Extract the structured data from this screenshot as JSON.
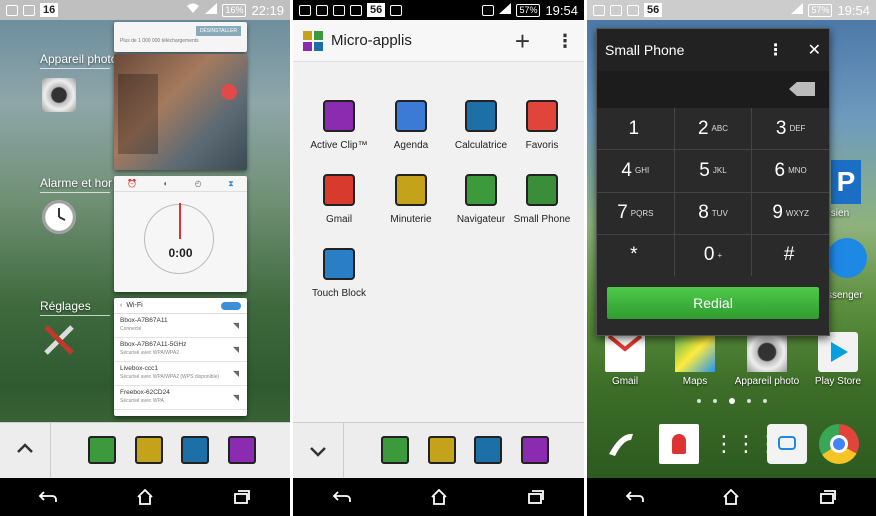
{
  "screen1": {
    "status": {
      "notif_count": "16",
      "battery": "16%",
      "time": "22:19"
    },
    "labels": {
      "camera": "Appareil photo",
      "alarm": "Alarme et hor",
      "settings": "Réglages"
    },
    "card_top_text": "Plus de 1 000 000 téléchargements",
    "card_top_button": "DÉSINSTALLER",
    "timer_value": "0:00",
    "wifi": {
      "title": "Wi-Fi",
      "networks": [
        {
          "name": "Bbox-A7B67A11",
          "status": "Connecté"
        },
        {
          "name": "Bbox-A7B67A11-5GHz",
          "status": "Sécurisé avec WPA/WPA2"
        },
        {
          "name": "Livebox-ccc1",
          "status": "Sécurisé avec WPA/WPA2 (WPS disponible)"
        },
        {
          "name": "Freebox-62CD24",
          "status": "Sécurisé avec WPA"
        }
      ]
    }
  },
  "screen2": {
    "status": {
      "notif_count": "56",
      "battery": "57%",
      "time": "19:54"
    },
    "title": "Micro-applis",
    "apps": [
      {
        "label": "Active Clip™",
        "color": "#8b2bb0"
      },
      {
        "label": "Agenda",
        "color": "#3b7bd6"
      },
      {
        "label": "Calculatrice",
        "color": "#1d6fa8"
      },
      {
        "label": "Favoris",
        "color": "#e0443a"
      },
      {
        "label": "Gmail",
        "color": "#d93a2e"
      },
      {
        "label": "Minuterie",
        "color": "#c4a21a"
      },
      {
        "label": "Navigateur",
        "color": "#3c9a3c"
      },
      {
        "label": "Small Phone",
        "color": "#3a8e3a"
      },
      {
        "label": "Touch Block",
        "color": "#2a7fc4"
      }
    ]
  },
  "screen3": {
    "status": {
      "notif_count": "56",
      "battery": "57%",
      "time": "19:54"
    },
    "phone_title": "Small Phone",
    "keys": [
      {
        "d": "1",
        "l": ""
      },
      {
        "d": "2",
        "l": "ABC"
      },
      {
        "d": "3",
        "l": "DEF"
      },
      {
        "d": "4",
        "l": "GHI"
      },
      {
        "d": "5",
        "l": "JKL"
      },
      {
        "d": "6",
        "l": "MNO"
      },
      {
        "d": "7",
        "l": "PQRS"
      },
      {
        "d": "8",
        "l": "TUV"
      },
      {
        "d": "9",
        "l": "WXYZ"
      },
      {
        "d": "*",
        "l": ""
      },
      {
        "d": "0",
        "l": "+"
      },
      {
        "d": "#",
        "l": ""
      }
    ],
    "redial": "Redial",
    "apps": {
      "gmail": "Gmail",
      "maps": "Maps",
      "camera": "Appareil photo",
      "store": "Play Store",
      "parisien": "Parisien",
      "messenger": "ssenger"
    }
  }
}
